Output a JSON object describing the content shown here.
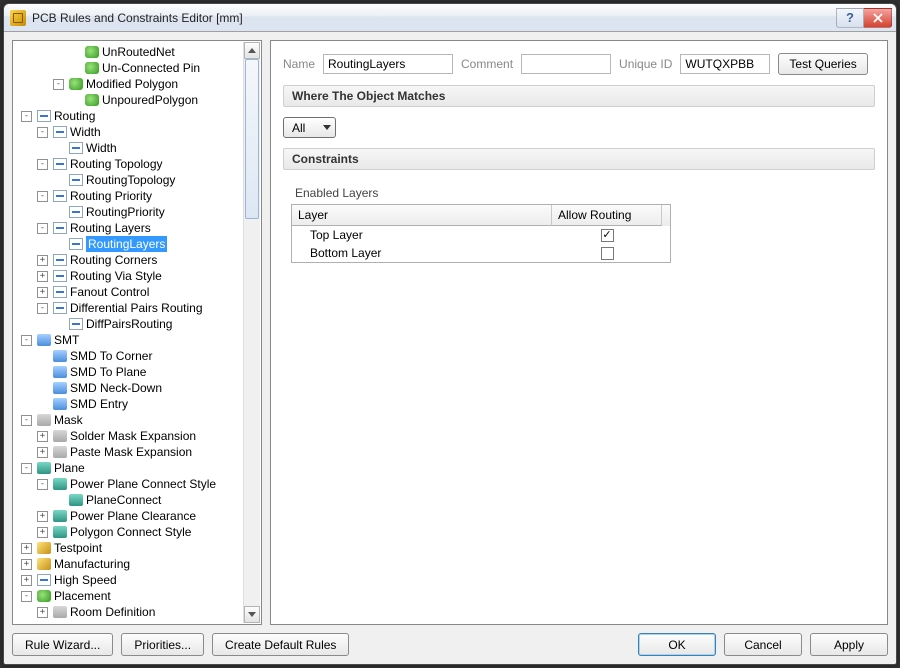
{
  "title": "PCB Rules and Constraints Editor [mm]",
  "tree": {
    "nodes": [
      {
        "d": 4,
        "t": "",
        "i": "ic-green",
        "l": "UnRoutedNet"
      },
      {
        "d": 4,
        "t": "",
        "i": "ic-green",
        "l": "Un-Connected Pin"
      },
      {
        "d": 3,
        "t": "-",
        "i": "ic-green",
        "l": "Modified Polygon"
      },
      {
        "d": 4,
        "t": "",
        "i": "ic-green",
        "l": "UnpouredPolygon"
      },
      {
        "d": 1,
        "t": "-",
        "i": "ic-route",
        "l": "Routing"
      },
      {
        "d": 2,
        "t": "-",
        "i": "ic-route",
        "l": "Width"
      },
      {
        "d": 3,
        "t": "",
        "i": "ic-route",
        "l": "Width"
      },
      {
        "d": 2,
        "t": "-",
        "i": "ic-route",
        "l": "Routing Topology"
      },
      {
        "d": 3,
        "t": "",
        "i": "ic-route",
        "l": "RoutingTopology"
      },
      {
        "d": 2,
        "t": "-",
        "i": "ic-route",
        "l": "Routing Priority"
      },
      {
        "d": 3,
        "t": "",
        "i": "ic-route",
        "l": "RoutingPriority"
      },
      {
        "d": 2,
        "t": "-",
        "i": "ic-route",
        "l": "Routing Layers"
      },
      {
        "d": 3,
        "t": "",
        "i": "ic-route",
        "l": "RoutingLayers",
        "sel": true
      },
      {
        "d": 2,
        "t": "+",
        "i": "ic-route",
        "l": "Routing Corners"
      },
      {
        "d": 2,
        "t": "+",
        "i": "ic-route",
        "l": "Routing Via Style"
      },
      {
        "d": 2,
        "t": "+",
        "i": "ic-route",
        "l": "Fanout Control"
      },
      {
        "d": 2,
        "t": "-",
        "i": "ic-route",
        "l": "Differential Pairs Routing"
      },
      {
        "d": 3,
        "t": "",
        "i": "ic-route",
        "l": "DiffPairsRouting"
      },
      {
        "d": 1,
        "t": "-",
        "i": "ic-blue",
        "l": "SMT"
      },
      {
        "d": 2,
        "t": "",
        "i": "ic-blue",
        "l": "SMD To Corner"
      },
      {
        "d": 2,
        "t": "",
        "i": "ic-blue",
        "l": "SMD To Plane"
      },
      {
        "d": 2,
        "t": "",
        "i": "ic-blue",
        "l": "SMD Neck-Down"
      },
      {
        "d": 2,
        "t": "",
        "i": "ic-blue",
        "l": "SMD Entry"
      },
      {
        "d": 1,
        "t": "-",
        "i": "ic-gray",
        "l": "Mask"
      },
      {
        "d": 2,
        "t": "+",
        "i": "ic-gray",
        "l": "Solder Mask Expansion"
      },
      {
        "d": 2,
        "t": "+",
        "i": "ic-gray",
        "l": "Paste Mask Expansion"
      },
      {
        "d": 1,
        "t": "-",
        "i": "ic-teal",
        "l": "Plane"
      },
      {
        "d": 2,
        "t": "-",
        "i": "ic-teal",
        "l": "Power Plane Connect Style"
      },
      {
        "d": 3,
        "t": "",
        "i": "ic-teal",
        "l": "PlaneConnect"
      },
      {
        "d": 2,
        "t": "+",
        "i": "ic-teal",
        "l": "Power Plane Clearance"
      },
      {
        "d": 2,
        "t": "+",
        "i": "ic-teal",
        "l": "Polygon Connect Style"
      },
      {
        "d": 1,
        "t": "+",
        "i": "ic-gold",
        "l": "Testpoint"
      },
      {
        "d": 1,
        "t": "+",
        "i": "ic-gold",
        "l": "Manufacturing"
      },
      {
        "d": 1,
        "t": "+",
        "i": "ic-route",
        "l": "High Speed"
      },
      {
        "d": 1,
        "t": "-",
        "i": "ic-green",
        "l": "Placement"
      },
      {
        "d": 2,
        "t": "+",
        "i": "ic-gray",
        "l": "Room Definition"
      }
    ]
  },
  "form": {
    "name_label": "Name",
    "name_value": "RoutingLayers",
    "comment_label": "Comment",
    "comment_value": "",
    "uid_label": "Unique ID",
    "uid_value": "WUTQXPBB",
    "test_queries": "Test Queries"
  },
  "match": {
    "header": "Where The Object Matches",
    "value": "All"
  },
  "constraints": {
    "header": "Constraints",
    "group": "Enabled Layers",
    "col_layer": "Layer",
    "col_allow": "Allow Routing",
    "rows": [
      {
        "layer": "Top Layer",
        "allow": true
      },
      {
        "layer": "Bottom Layer",
        "allow": false
      }
    ]
  },
  "footer": {
    "rule_wizard": "Rule Wizard...",
    "priorities": "Priorities...",
    "create_defaults": "Create Default Rules",
    "ok": "OK",
    "cancel": "Cancel",
    "apply": "Apply"
  }
}
